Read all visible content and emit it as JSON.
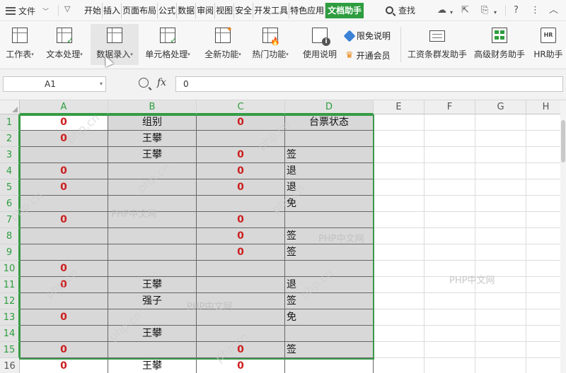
{
  "menubar": {
    "file_label": "文件",
    "tabs": [
      "开始",
      "插入",
      "页面布局",
      "公式",
      "数据",
      "审阅",
      "视图",
      "安全",
      "开发工具",
      "特色应用",
      "文档助手"
    ],
    "search_label": "查找"
  },
  "toolbar": {
    "buttons": [
      {
        "label": "工作表"
      },
      {
        "label": "文本处理"
      },
      {
        "label": "数据录入"
      },
      {
        "label": "单元格处理"
      },
      {
        "label": "全新功能"
      },
      {
        "label": "热门功能"
      },
      {
        "label": "使用说明"
      },
      {
        "label": "工资条群发助手"
      },
      {
        "label": "高级财务助手"
      },
      {
        "label": "HR助手"
      }
    ],
    "limited_free": "限免说明",
    "membership": "开通会员",
    "hr_icon_text": "HR"
  },
  "formula_bar": {
    "cell_ref": "A1",
    "fx": "fx",
    "value": "0"
  },
  "sheet": {
    "columns": [
      "A",
      "B",
      "C",
      "D",
      "E",
      "F",
      "G",
      "H"
    ],
    "rows": [
      {
        "n": "1",
        "a": "0",
        "b": "组别",
        "c": "0",
        "d": "台票状态"
      },
      {
        "n": "2",
        "a": "0",
        "b": "王攀",
        "c": "",
        "d": ""
      },
      {
        "n": "3",
        "a": "",
        "b": "王攀",
        "c": "0",
        "d": "签"
      },
      {
        "n": "4",
        "a": "0",
        "b": "",
        "c": "0",
        "d": "退"
      },
      {
        "n": "5",
        "a": "0",
        "b": "",
        "c": "0",
        "d": "退"
      },
      {
        "n": "6",
        "a": "",
        "b": "",
        "c": "",
        "d": "免"
      },
      {
        "n": "7",
        "a": "0",
        "b": "",
        "c": "0",
        "d": ""
      },
      {
        "n": "8",
        "a": "",
        "b": "",
        "c": "0",
        "d": "签"
      },
      {
        "n": "9",
        "a": "",
        "b": "",
        "c": "0",
        "d": "签"
      },
      {
        "n": "10",
        "a": "0",
        "b": "",
        "c": "",
        "d": ""
      },
      {
        "n": "11",
        "a": "0",
        "b": "王攀",
        "c": "",
        "d": "退"
      },
      {
        "n": "12",
        "a": "",
        "b": "强子",
        "c": "",
        "d": "签"
      },
      {
        "n": "13",
        "a": "0",
        "b": "",
        "c": "",
        "d": "免"
      },
      {
        "n": "14",
        "a": "",
        "b": "王攀",
        "c": "",
        "d": ""
      },
      {
        "n": "15",
        "a": "0",
        "b": "",
        "c": "0",
        "d": "签"
      },
      {
        "n": "16",
        "a": "0",
        "b": "王攀",
        "c": "0",
        "d": ""
      }
    ]
  },
  "watermark": {
    "cn": "PHP中文网",
    "site": "php.cn"
  },
  "colors": {
    "accent": "#2e9d3f",
    "value_red": "#cc1f1f",
    "selection_fill": "#d8d8d8"
  }
}
